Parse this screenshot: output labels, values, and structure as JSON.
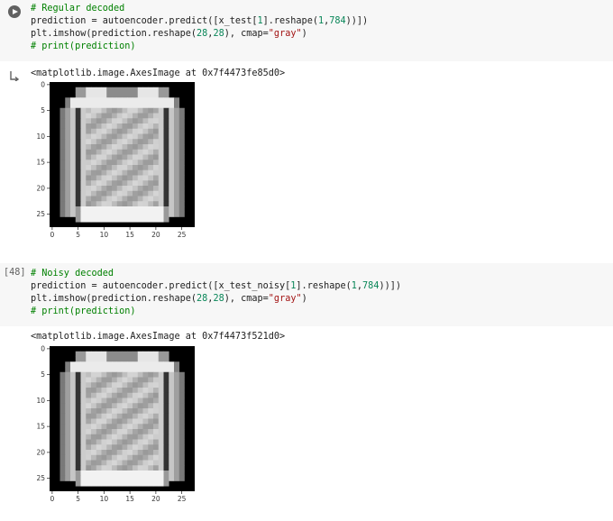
{
  "cell1": {
    "lines": [
      {
        "kind": "comment",
        "text": "# Regular decoded"
      },
      {
        "kind": "code",
        "parts": [
          [
            "t",
            "prediction = autoencoder.predict([x_test["
          ],
          [
            "n",
            "1"
          ],
          [
            "t",
            "].reshape("
          ],
          [
            "n",
            "1"
          ],
          [
            "t",
            ","
          ],
          [
            "n",
            "784"
          ],
          [
            "t",
            "))])"
          ]
        ]
      },
      {
        "kind": "code",
        "parts": [
          [
            "t",
            "plt.imshow(prediction.reshape("
          ],
          [
            "n",
            "28"
          ],
          [
            "t",
            ","
          ],
          [
            "n",
            "28"
          ],
          [
            "t",
            "), cmap="
          ],
          [
            "s",
            "\"gray\""
          ],
          [
            "t",
            ")"
          ]
        ]
      },
      {
        "kind": "comment",
        "text": "# print(prediction)"
      }
    ],
    "output_text": "<matplotlib.image.AxesImage at 0x7f4473fe85d0>"
  },
  "cell2": {
    "exec_count": "[48]",
    "lines": [
      {
        "kind": "comment",
        "text": "# Noisy decoded"
      },
      {
        "kind": "code",
        "parts": [
          [
            "t",
            "prediction = autoencoder.predict([x_test_noisy["
          ],
          [
            "n",
            "1"
          ],
          [
            "t",
            "].reshape("
          ],
          [
            "n",
            "1"
          ],
          [
            "t",
            ","
          ],
          [
            "n",
            "784"
          ],
          [
            "t",
            "))])"
          ]
        ]
      },
      {
        "kind": "code",
        "parts": [
          [
            "t",
            "plt.imshow(prediction.reshape("
          ],
          [
            "n",
            "28"
          ],
          [
            "t",
            ","
          ],
          [
            "n",
            "28"
          ],
          [
            "t",
            "), cmap="
          ],
          [
            "s",
            "\"gray\""
          ],
          [
            "t",
            ")"
          ]
        ]
      },
      {
        "kind": "comment",
        "text": "# print(prediction)"
      }
    ],
    "output_text": "<matplotlib.image.AxesImage at 0x7f4473f521d0>"
  },
  "axes": {
    "y_ticks": [
      "0",
      "5",
      "10",
      "15",
      "20",
      "25"
    ],
    "x_ticks": [
      "0",
      "5",
      "10",
      "15",
      "20",
      "25"
    ]
  }
}
